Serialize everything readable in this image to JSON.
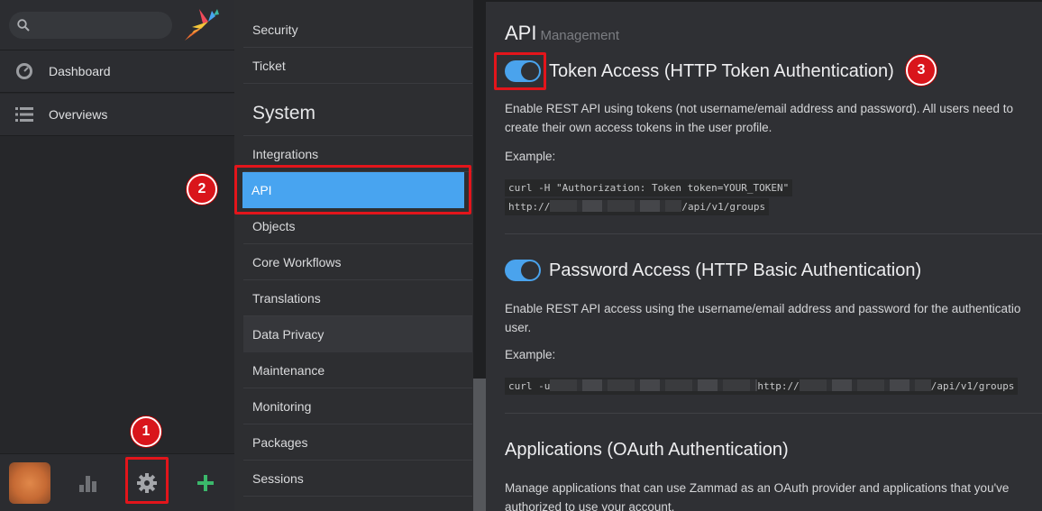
{
  "nav": {
    "search_placeholder": "",
    "items": [
      {
        "label": "Dashboard",
        "icon": "dashboard-icon"
      },
      {
        "label": "Overviews",
        "icon": "overviews-icon"
      }
    ],
    "bottom": [
      {
        "icon": "avatar"
      },
      {
        "icon": "reporting-icon"
      },
      {
        "icon": "gear-icon"
      },
      {
        "icon": "plus-icon",
        "color": "#3bb86b"
      }
    ]
  },
  "settings": {
    "items_top": [
      "Security",
      "Ticket"
    ],
    "section_heading": "System",
    "items": [
      "Integrations",
      "API",
      "Objects",
      "Core Workflows",
      "Translations",
      "Data Privacy",
      "Maintenance",
      "Monitoring",
      "Packages",
      "Sessions"
    ],
    "active": "API"
  },
  "main": {
    "title": "API",
    "subtitle": "Management",
    "token": {
      "title": "Token Access (HTTP Token Authentication)",
      "enabled": true,
      "desc_line1": "Enable REST API using tokens (not username/email address and password). All users need to",
      "desc_line2": "create their own access tokens in the user profile.",
      "example_label": "Example:",
      "code_line1": "curl -H \"Authorization: Token token=YOUR_TOKEN\"",
      "code_line2_prefix": "http://",
      "code_line2_suffix": "/api/v1/groups"
    },
    "password": {
      "title": "Password Access (HTTP Basic Authentication)",
      "enabled": true,
      "desc_line1": "Enable REST API access using the username/email address and password for the authenticatio",
      "desc_line2": "user.",
      "example_label": "Example:",
      "code_prefix": "curl -u",
      "code_mid": "http://",
      "code_suffix": "/api/v1/groups"
    },
    "oauth": {
      "title": "Applications (OAuth Authentication)",
      "desc_line1": "Manage applications that can use Zammad as an OAuth provider and applications that you've",
      "desc_line2": "authorized to use your account."
    }
  },
  "annotations": {
    "badge1": "1",
    "badge2": "2",
    "badge3": "3",
    "color": "#e3151b"
  }
}
